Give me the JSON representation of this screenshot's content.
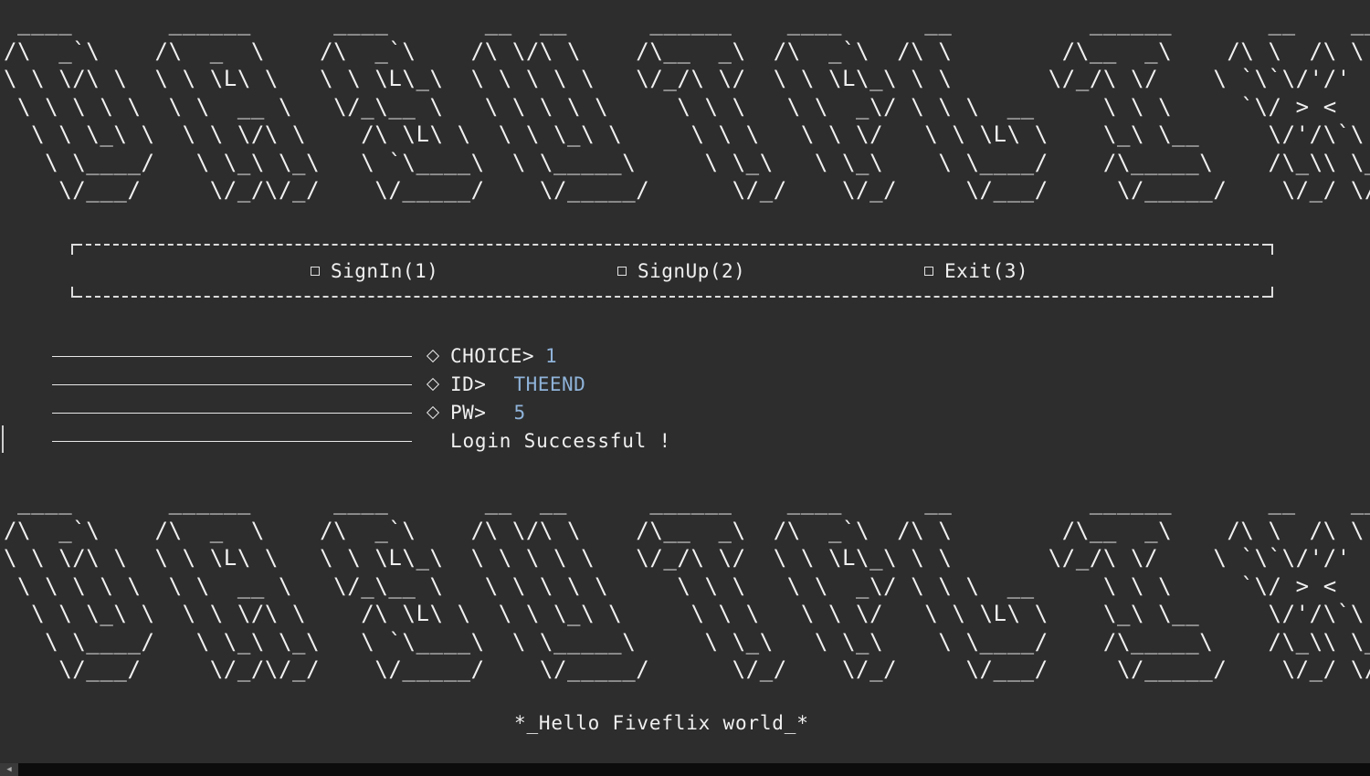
{
  "banner": {
    "art": " ____       ______      ____       __  __      ______    ____      __          ______       __    __\n/\\  _`\\    /\\  _  \\    /\\  _`\\    /\\ \\/\\ \\    /\\__  _\\  /\\  _`\\  /\\ \\        /\\__  _\\    /\\ \\  /\\ \\\n\\ \\ \\/\\ \\  \\ \\ \\L\\ \\   \\ \\ \\L\\_\\  \\ \\ \\ \\ \\   \\/_/\\ \\/  \\ \\ \\L\\_\\ \\ \\       \\/_/\\ \\/    \\ `\\`\\/'/'\n \\ \\ \\ \\ \\  \\ \\  __ \\   \\/_\\__ \\   \\ \\ \\ \\ \\     \\ \\ \\   \\ \\  _\\/ \\ \\ \\  __     \\ \\ \\     `\\/ > <\n  \\ \\ \\_\\ \\  \\ \\ \\/\\ \\    /\\ \\L\\ \\  \\ \\ \\_\\ \\     \\ \\ \\   \\ \\ \\/   \\ \\ \\L\\ \\    \\_\\ \\__     \\/'/\\`\\\n   \\ \\____/   \\ \\_\\ \\_\\   \\ `\\____\\  \\ \\_____\\     \\ \\_\\   \\ \\_\\    \\ \\____/    /\\_____\\    /\\_\\\\ \\_\\\n    \\/___/     \\/_/\\/_/    \\/_____/    \\/_____/      \\/_/    \\/_/     \\/___/     \\/_____/    \\/_/ \\/_/"
  },
  "menu": {
    "items": [
      {
        "label": "SignIn(1)"
      },
      {
        "label": "SignUp(2)"
      },
      {
        "label": "Exit(3)"
      }
    ]
  },
  "prompts": {
    "choice_label": "CHOICE>",
    "choice_value": "1",
    "id_label": "ID>",
    "id_value": "THEEND",
    "pw_label": "PW>",
    "pw_value": "5",
    "result_message": "Login Successful !"
  },
  "footer": {
    "greeting": "*_Hello Fiveflix world_*"
  },
  "colors": {
    "background": "#2d2d2d",
    "text": "#f0f0f0",
    "input_value": "#8fb3d9"
  }
}
